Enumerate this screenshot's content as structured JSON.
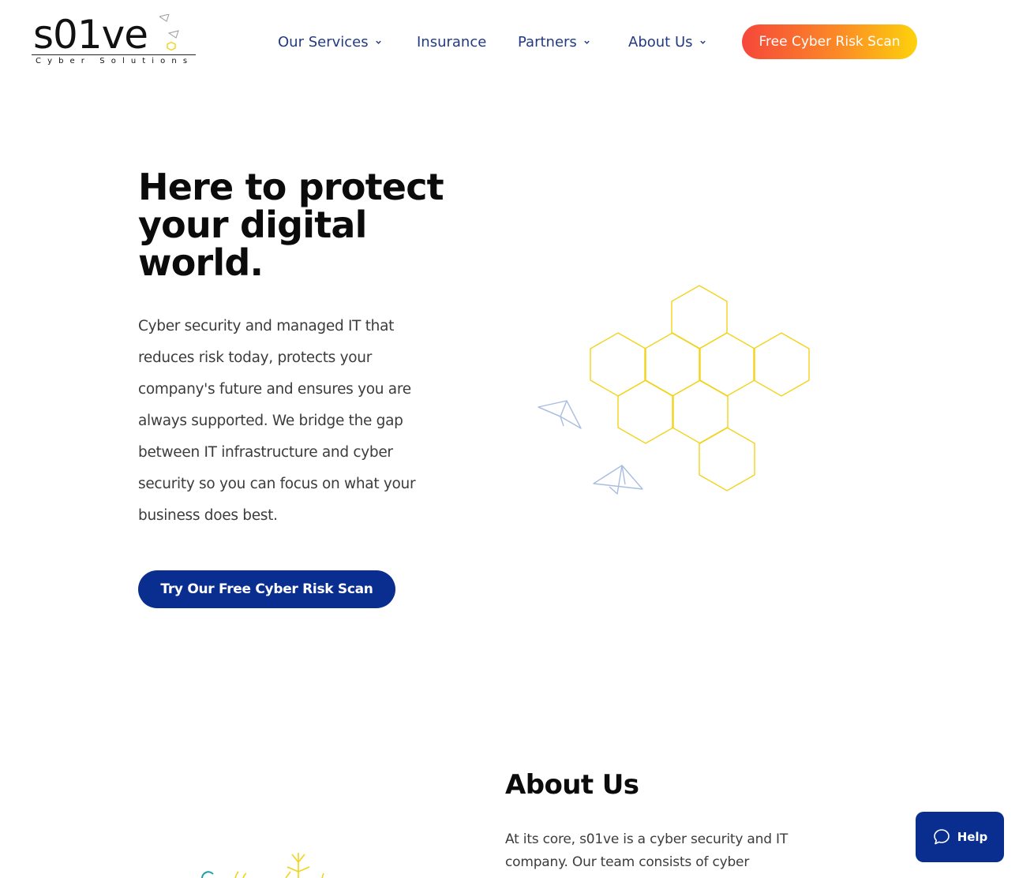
{
  "logo": {
    "wordmark": "s01ve",
    "tagline": "Cyber Solutions"
  },
  "nav": {
    "items": [
      {
        "label": "Our Services",
        "has_dropdown": true
      },
      {
        "label": "Insurance",
        "has_dropdown": false
      },
      {
        "label": "Partners",
        "has_dropdown": true
      },
      {
        "label": "About Us",
        "has_dropdown": true
      }
    ],
    "cta_label": "Free Cyber Risk Scan"
  },
  "hero": {
    "title": "Here to protect your digital world.",
    "body": "Cyber security and managed IT that reduces risk today, protects your company's future and ensures you are always supported. We bridge the gap between IT infrastructure and cyber security so you can focus on what your business does best.",
    "button_label": "Try Our Free Cyber Risk Scan",
    "illustration": "hexagon-cluster-with-paper-planes"
  },
  "about": {
    "title": "About Us",
    "body": "At its core, s01ve is a cyber security and IT company. Our team consists of cyber"
  },
  "help_widget": {
    "label": "Help",
    "icon": "chat-bubble-icon"
  },
  "colors": {
    "nav_text": "#213a83",
    "primary_blue": "#0a2e8f",
    "gradient_start": "#f6473b",
    "gradient_end": "#fdd20c",
    "hexagon_yellow": "#f2d31a",
    "plane_blue": "#a9bde2"
  }
}
